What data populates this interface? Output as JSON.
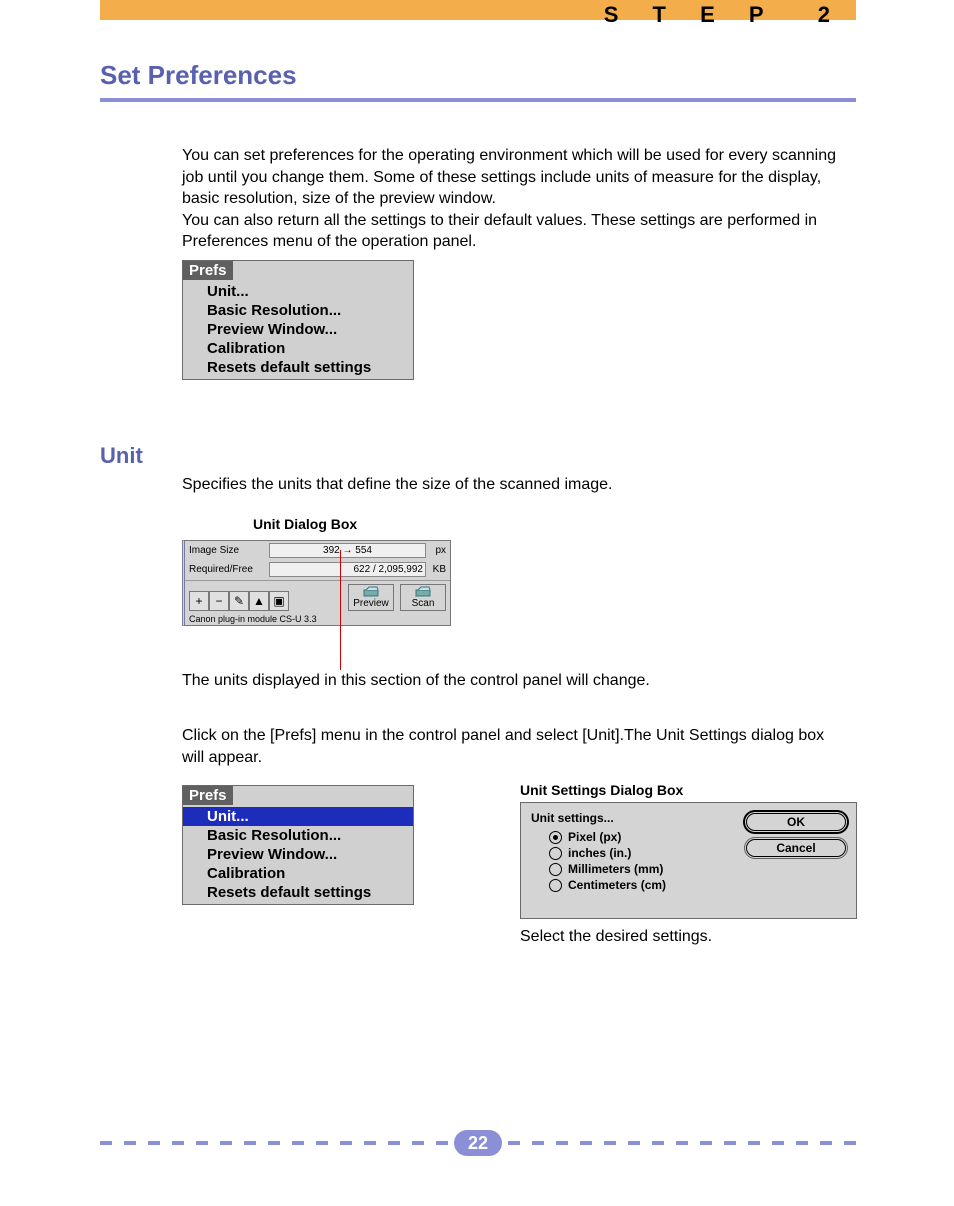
{
  "header": {
    "step_label": "S T E P 2"
  },
  "title": "Set Preferences",
  "intro": "You can set preferences for the operating environment which will be used for every scanning job until you change them.  Some of these settings include units of measure for the display, basic resolution, size of the preview window.\nYou can also return all the settings to their default values.  These settings are performed in Preferences menu of the operation panel.",
  "prefs_menu": {
    "header": "Prefs",
    "items": [
      "Unit...",
      "Basic Resolution...",
      "Preview Window...",
      "Calibration",
      "Resets default settings"
    ]
  },
  "section": {
    "heading": "Unit",
    "desc": "Specifies the units that define the size of the scanned image."
  },
  "fig1": {
    "label": "Unit Dialog Box",
    "image_size_label": "Image Size",
    "image_size_value": "392 → 554",
    "image_size_unit": "px",
    "required_label": "Required/Free",
    "required_value": "622 / 2,095,992",
    "required_unit": "KB",
    "preview_btn": "Preview",
    "scan_btn": "Scan",
    "footer": "Canon plug-in module CS-U 3.3"
  },
  "caption1": "The units displayed in this section of the control panel will change.",
  "para2": "Click on the [Prefs] menu in the control panel and select [Unit].The Unit Settings dialog box will appear.",
  "fig2": {
    "label": "Unit Settings Dialog Box",
    "heading": "Unit settings...",
    "options": [
      "Pixel (px)",
      "inches (in.)",
      "Millimeters (mm)",
      "Centimeters (cm)"
    ],
    "ok": "OK",
    "cancel": "Cancel"
  },
  "caption2": "Select the desired settings.",
  "page_number": "22"
}
